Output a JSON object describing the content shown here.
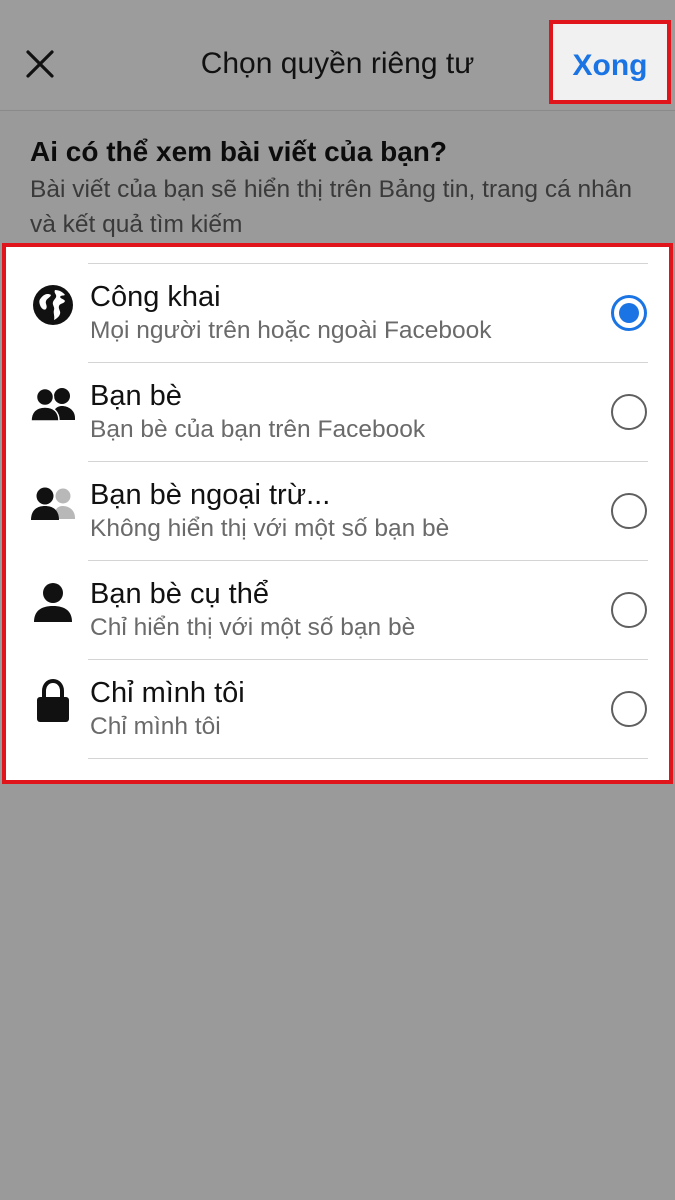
{
  "header": {
    "title": "Chọn quyền riêng tư",
    "done_label": "Xong",
    "done_color": "#1b74e4",
    "close_icon": "close-icon"
  },
  "question": {
    "title": "Ai có thể xem bài viết của bạn?",
    "description": "Bài viết của bạn sẽ hiển thị trên Bảng tin, trang cá nhân và kết quả tìm kiếm"
  },
  "options": [
    {
      "label": "Công khai",
      "sublabel": "Mọi người trên hoặc ngoài Facebook",
      "icon": "globe-icon",
      "selected": true
    },
    {
      "label": "Bạn bè",
      "sublabel": "Bạn bè của bạn trên Facebook",
      "icon": "friends-icon",
      "selected": false
    },
    {
      "label": "Bạn bè ngoại trừ...",
      "sublabel": "Không hiển thị với một số bạn bè",
      "icon": "friends-except-icon",
      "selected": false
    },
    {
      "label": "Bạn bè cụ thể",
      "sublabel": "Chỉ hiển thị với một số bạn bè",
      "icon": "person-icon",
      "selected": false
    },
    {
      "label": "Chỉ mình tôi",
      "sublabel": "Chỉ mình tôi",
      "icon": "lock-icon",
      "selected": false
    }
  ],
  "colors": {
    "highlight_border": "#e0141b",
    "accent": "#1b74e4",
    "overlay": "#9a9a9a"
  }
}
